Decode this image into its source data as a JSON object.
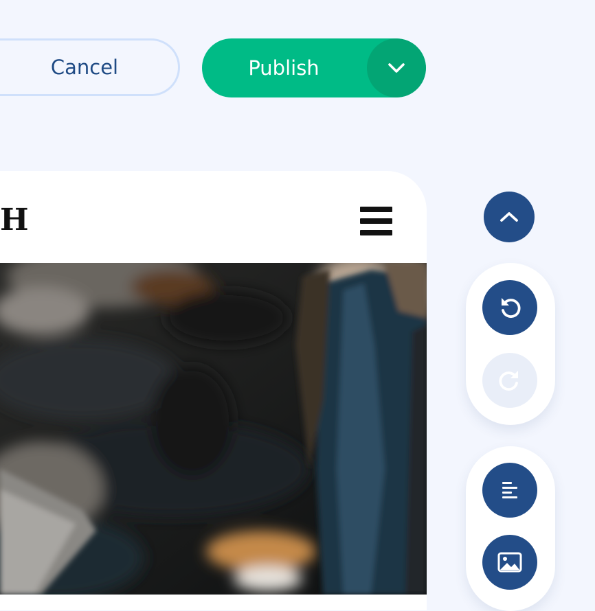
{
  "toolbar": {
    "cancel_label": "Cancel",
    "publish_label": "Publish"
  },
  "preview": {
    "logo_partial": "H"
  },
  "colors": {
    "background": "#f3f6fe",
    "publish_green": "#00bb86",
    "publish_arrow_green": "#03a574",
    "navy": "#234d88",
    "cancel_border": "#cfe0fb",
    "disabled_circle": "#e9eef8"
  },
  "side_tools": {
    "icons": [
      "chevron-up-icon",
      "undo-icon",
      "redo-icon",
      "text-align-icon",
      "image-icon"
    ]
  }
}
